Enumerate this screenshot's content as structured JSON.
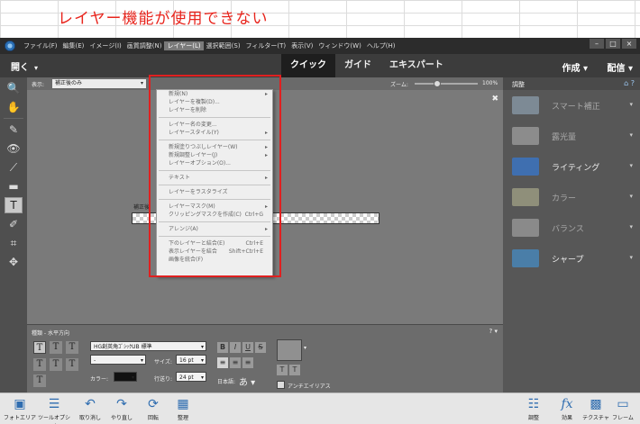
{
  "headline": "レイヤー機能が使用できない",
  "menubar": {
    "items": [
      "ファイル(F)",
      "編集(E)",
      "イメージ(I)",
      "画質調整(N)",
      "レイヤー(L)",
      "選択範囲(S)",
      "フィルター(T)",
      "表示(V)",
      "ウィンドウ(W)",
      "ヘルプ(H)"
    ],
    "active_index": 4,
    "window_controls": [
      "–",
      "□",
      "×"
    ]
  },
  "topbar": {
    "open_label": "開く",
    "modes": [
      "クイック",
      "ガイド",
      "エキスパート"
    ],
    "active_mode": "クイック",
    "create_label": "作成",
    "share_label": "配信"
  },
  "options": {
    "display_label": "表示:",
    "display_value": "補正後のみ",
    "zoom_label": "ズーム:",
    "zoom_value": "100%",
    "zoom_fraction": 0.3
  },
  "document": {
    "label": "補正後"
  },
  "layer_menu": {
    "items": [
      {
        "label": "新規(N)",
        "arrow": true
      },
      {
        "label": "レイヤーを複製(D)...",
        "arrow": false
      },
      {
        "label": "レイヤーを削除",
        "arrow": false
      },
      {
        "sep": true
      },
      {
        "label": "レイヤー名の変更...",
        "arrow": false
      },
      {
        "label": "レイヤースタイル(Y)",
        "arrow": true
      },
      {
        "sep": true
      },
      {
        "label": "新規塗りつぶしレイヤー(W)",
        "arrow": true
      },
      {
        "label": "新規調整レイヤー(J)",
        "arrow": true
      },
      {
        "label": "レイヤーオプション(O)...",
        "arrow": false
      },
      {
        "sep": true
      },
      {
        "label": "テキスト",
        "arrow": true
      },
      {
        "sep": true
      },
      {
        "label": "レイヤーをラスタライズ",
        "arrow": false
      },
      {
        "sep": true
      },
      {
        "label": "レイヤーマスク(M)",
        "arrow": true
      },
      {
        "label": "クリッピングマスクを作成(C)",
        "shortcut": "Ctrl+G"
      },
      {
        "sep": true
      },
      {
        "label": "アレンジ(A)",
        "arrow": true
      },
      {
        "sep": true
      },
      {
        "label": "下のレイヤーと結合(E)",
        "shortcut": "Ctrl+E"
      },
      {
        "label": "表示レイヤーを結合",
        "shortcut": "Shift+Ctrl+E"
      },
      {
        "label": "画像を統合(F)",
        "arrow": false
      }
    ]
  },
  "right_panel": {
    "title": "調整",
    "adjustments": [
      {
        "name": "スマート補正",
        "enabled": false,
        "color": "#7d8a95"
      },
      {
        "name": "露光量",
        "enabled": false,
        "color": "#8c8c8c"
      },
      {
        "name": "ライティング",
        "enabled": true,
        "color": "#3f6fb0"
      },
      {
        "name": "カラー",
        "enabled": false,
        "color": "#8f8f7a"
      },
      {
        "name": "バランス",
        "enabled": false,
        "color": "#8a8a8a"
      },
      {
        "name": "シャープ",
        "enabled": true,
        "color": "#4a7ea8"
      }
    ]
  },
  "text_panel": {
    "title": "種類 - 水平方向",
    "font_family": "HG創英角ｺﾞｼｯｸUB 標準",
    "font_style": "-",
    "size_label": "サイズ:",
    "size_value": "16 pt",
    "color_label": "カラー:",
    "leading_label": "行送り:",
    "leading_value": "24 pt",
    "language_label": "日本語:",
    "antialias_label": "アンチエイリアス",
    "format_buttons": [
      "B",
      "I",
      "U",
      "S"
    ]
  },
  "bottombar": {
    "left": [
      "フォトエリア",
      "ツールオプション",
      "取り消し",
      "やり直し",
      "回転",
      "整理"
    ],
    "right": [
      "調整",
      "効果",
      "テクスチャ",
      "フレーム"
    ]
  }
}
